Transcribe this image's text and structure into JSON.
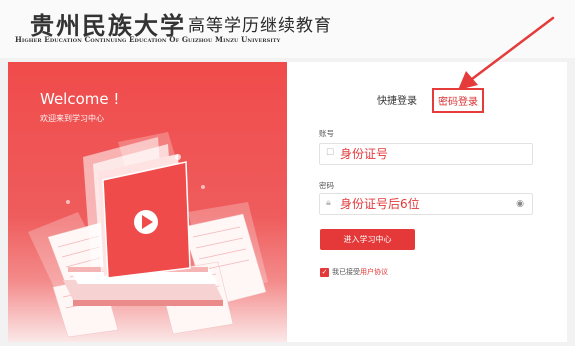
{
  "header": {
    "logo_calligraphy": "贵州民族大学",
    "title_cn": "高等学历继续教育",
    "title_en": "Higher Education Continuing Education Of Guizhou Minzu University"
  },
  "promo": {
    "welcome": "Welcome !",
    "welcome_sub": "欢迎来到学习中心"
  },
  "tabs": {
    "quick_login": "快捷登录",
    "password_login": "密码登录"
  },
  "form": {
    "account_label": "账号",
    "account_placeholder": "身份证号",
    "password_label": "密码",
    "password_placeholder": "身份证号后6位",
    "submit_label": "进入学习中心",
    "agree_text": "我已接受",
    "agree_link": "用户协议"
  },
  "colors": {
    "brand_red": "#e53838",
    "annotation_red": "#e53b3b"
  },
  "icons": {
    "account": "user-icon",
    "password": "lock-icon",
    "toggle": "eye-icon",
    "check": "check-icon",
    "arrow": "annotation-arrow"
  }
}
